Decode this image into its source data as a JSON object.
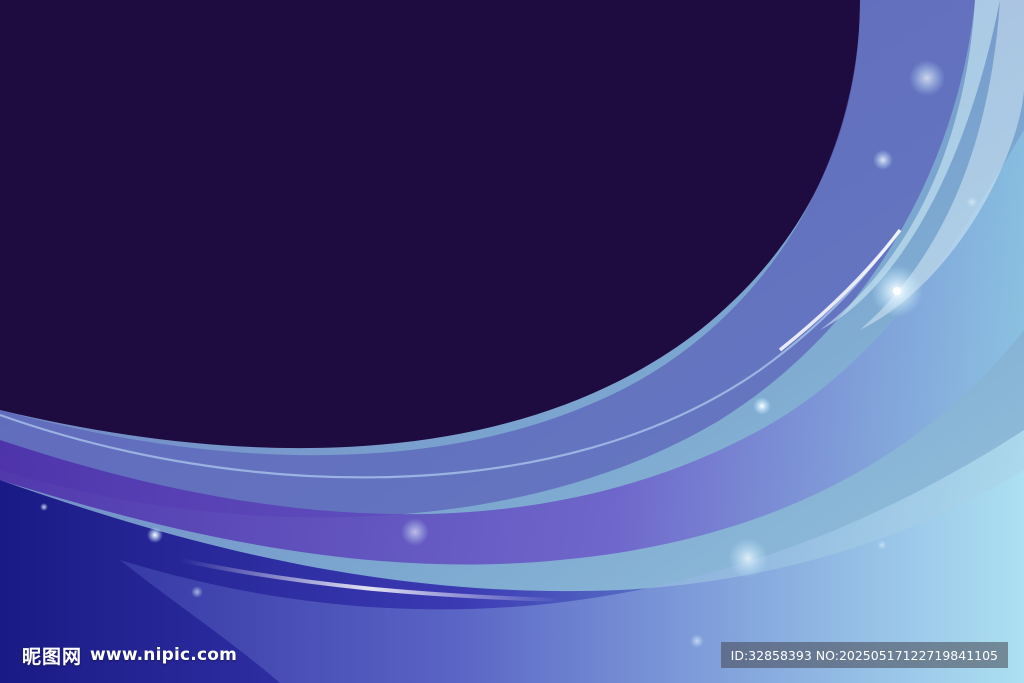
{
  "image": {
    "subject": "abstract-purple-blue-wave-background",
    "colors": {
      "dark_purple": "#1e0b40",
      "deep_blue": "#201a8a",
      "violet": "#6a4bc6",
      "periwinkle": "#7b86d6",
      "light_blue": "#8fd0ea",
      "highlight": "#ffffff"
    }
  },
  "watermark": {
    "brand": "昵图网",
    "url": "www.nipic.com",
    "id_text": "ID:32858393 NO:20250517122719841105"
  }
}
